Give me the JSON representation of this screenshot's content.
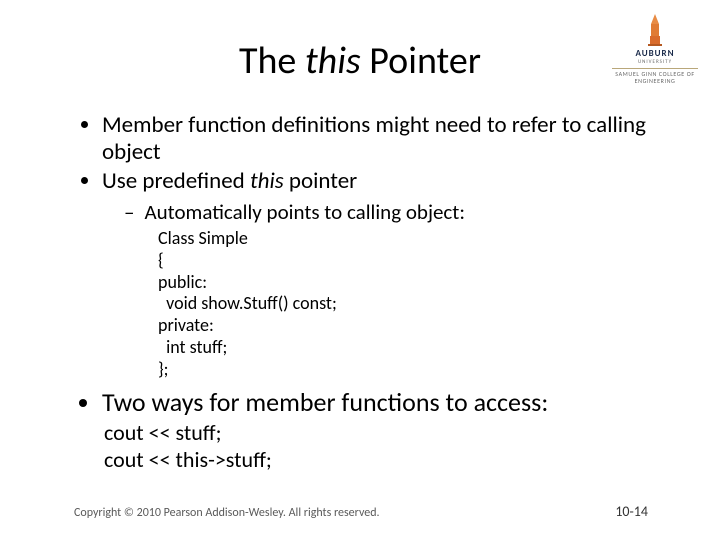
{
  "logo": {
    "university": "AUBURN",
    "subline1": "UNIVERSITY",
    "college": "SAMUEL GINN\nCOLLEGE OF ENGINEERING"
  },
  "title_pre": "The ",
  "title_it": "this",
  "title_post": " Pointer",
  "b1": "Member function definitions might need to refer to calling object",
  "b2_pre": "Use predefined ",
  "b2_it": "this",
  "b2_post": " pointer",
  "d1": "Automatically points to calling object:",
  "code1": "Class Simple\n{\npublic:\n  void show.Stuff() const;\nprivate:\n  int stuff;\n};",
  "b3": "Two ways for member functions to access:",
  "code2": "cout << stuff;\ncout << this->stuff;",
  "copyright": "Copyright © 2010 Pearson Addison-Wesley. All rights reserved.",
  "pagenum": "10-14"
}
